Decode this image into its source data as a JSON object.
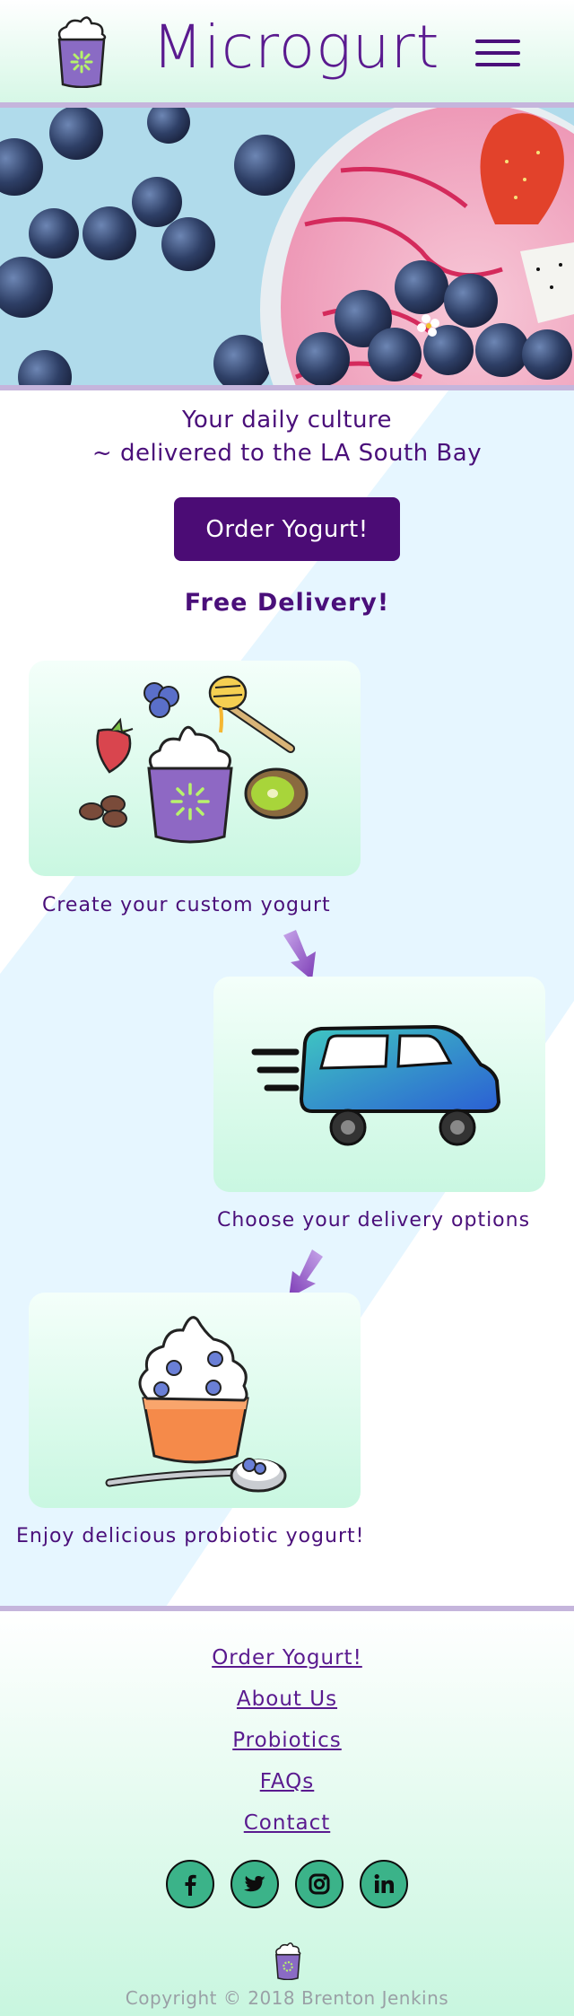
{
  "header": {
    "brand": "Microgurt",
    "menu_icon": "hamburger-menu-icon"
  },
  "hero": {
    "image_subject": "berry yogurt bowl with blueberries and strawberry"
  },
  "tagline": {
    "line1": "Your daily culture",
    "line2": "~ delivered to the LA South Bay"
  },
  "cta": {
    "order_label": "Order Yogurt!"
  },
  "delivery_note": "Free Delivery!",
  "steps": [
    {
      "label": "Create your custom yogurt",
      "icon": "yogurt-toppings-icon"
    },
    {
      "label": "Choose your delivery options",
      "icon": "delivery-car-icon"
    },
    {
      "label": "Enjoy delicious probiotic yogurt!",
      "icon": "yogurt-cup-spoon-icon"
    }
  ],
  "footer": {
    "links": [
      "Order Yogurt!",
      "About Us",
      "Probiotics",
      "FAQs",
      "Contact"
    ],
    "socials": [
      "facebook-icon",
      "twitter-icon",
      "instagram-icon",
      "linkedin-icon"
    ],
    "copyright": "Copyright © 2018 Brenton Jenkins"
  },
  "colors": {
    "brand_purple": "#4b0c75",
    "mint": "#c9f7e1",
    "light_blue": "#e6f6ff",
    "divider": "#c5b5dc",
    "social_green": "#3bb389"
  }
}
